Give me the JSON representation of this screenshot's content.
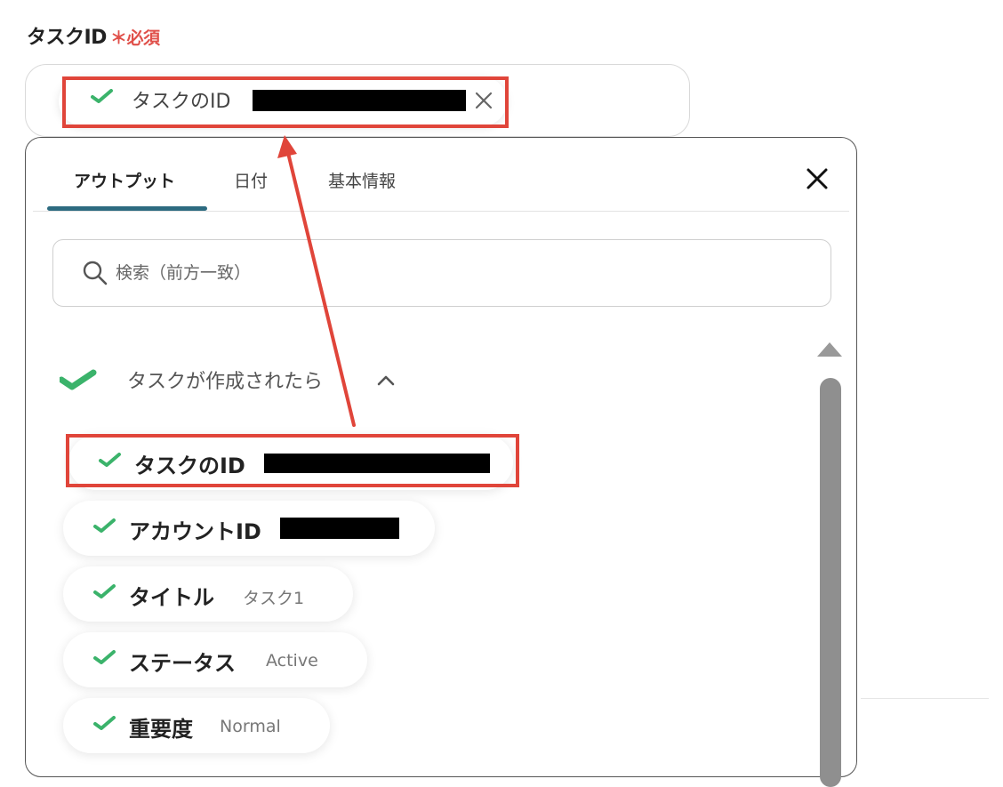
{
  "field": {
    "label": "タスクID",
    "required_mark": "＊必須",
    "selected_chip": {
      "label": "タスクのID",
      "icon": "green-check-icon",
      "remove_icon": "close-icon"
    }
  },
  "panel": {
    "tabs": [
      {
        "label": "アウトプット",
        "active": true
      },
      {
        "label": "日付",
        "active": false
      },
      {
        "label": "基本情報",
        "active": false
      }
    ],
    "close_icon": "close-icon",
    "search": {
      "placeholder": "検索（前方一致）",
      "icon": "search-icon"
    },
    "group": {
      "title": "タスクが作成されたら",
      "expanded": true,
      "icon": "green-check-icon"
    },
    "items": [
      {
        "name": "タスクのID",
        "value": "",
        "value_redacted": true
      },
      {
        "name": "アカウントID",
        "value": "",
        "value_redacted": true
      },
      {
        "name": "タイトル",
        "value": "タスク1"
      },
      {
        "name": "ステータス",
        "value": "Active"
      },
      {
        "name": "重要度",
        "value": "Normal"
      }
    ]
  },
  "colors": {
    "accent": "#2d6b80",
    "required": "#e0504a",
    "check": "#3bb36b",
    "annotation": "#e0453a"
  }
}
